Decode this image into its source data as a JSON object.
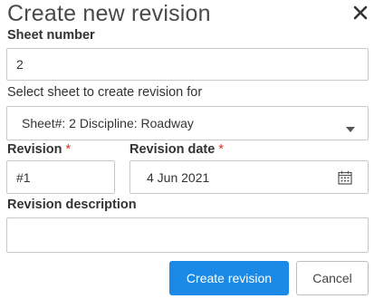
{
  "dialog": {
    "title": "Create new revision",
    "close_icon": "close-icon"
  },
  "sheet_number": {
    "label": "Sheet number",
    "value": "2"
  },
  "select_sheet": {
    "label": "Select sheet to create revision for",
    "value": "Sheet#: 2 Discipline: Roadway",
    "dropdown_icon": "chevron-down-icon"
  },
  "revision": {
    "label": "Revision",
    "required_marker": "*",
    "value": "#1"
  },
  "revision_date": {
    "label": "Revision date",
    "required_marker": "*",
    "value": "4 Jun 2021",
    "calendar_icon": "calendar-icon"
  },
  "revision_description": {
    "label": "Revision description",
    "value": ""
  },
  "buttons": {
    "create": "Create revision",
    "cancel": "Cancel"
  },
  "colors": {
    "primary": "#1a8ae6",
    "required": "#d93025"
  }
}
